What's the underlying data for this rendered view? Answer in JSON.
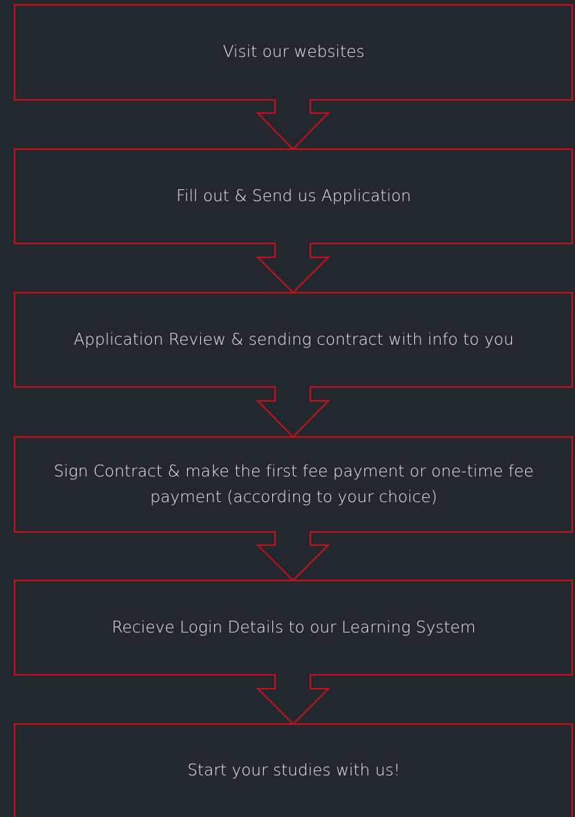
{
  "colors": {
    "background": "#23272e",
    "outline": "#c0141c",
    "text": "#e9e9e9"
  },
  "steps": [
    {
      "label": "Visit our websites"
    },
    {
      "label": "Fill out & Send us Application"
    },
    {
      "label": "Application Review & sending contract with info to you"
    },
    {
      "label": "Sign Contract & make the first fee payment or one-time fee payment (according to your choice)"
    },
    {
      "label": "Recieve Login Details to our Learning System"
    },
    {
      "label": "Start your studies with us!"
    }
  ]
}
